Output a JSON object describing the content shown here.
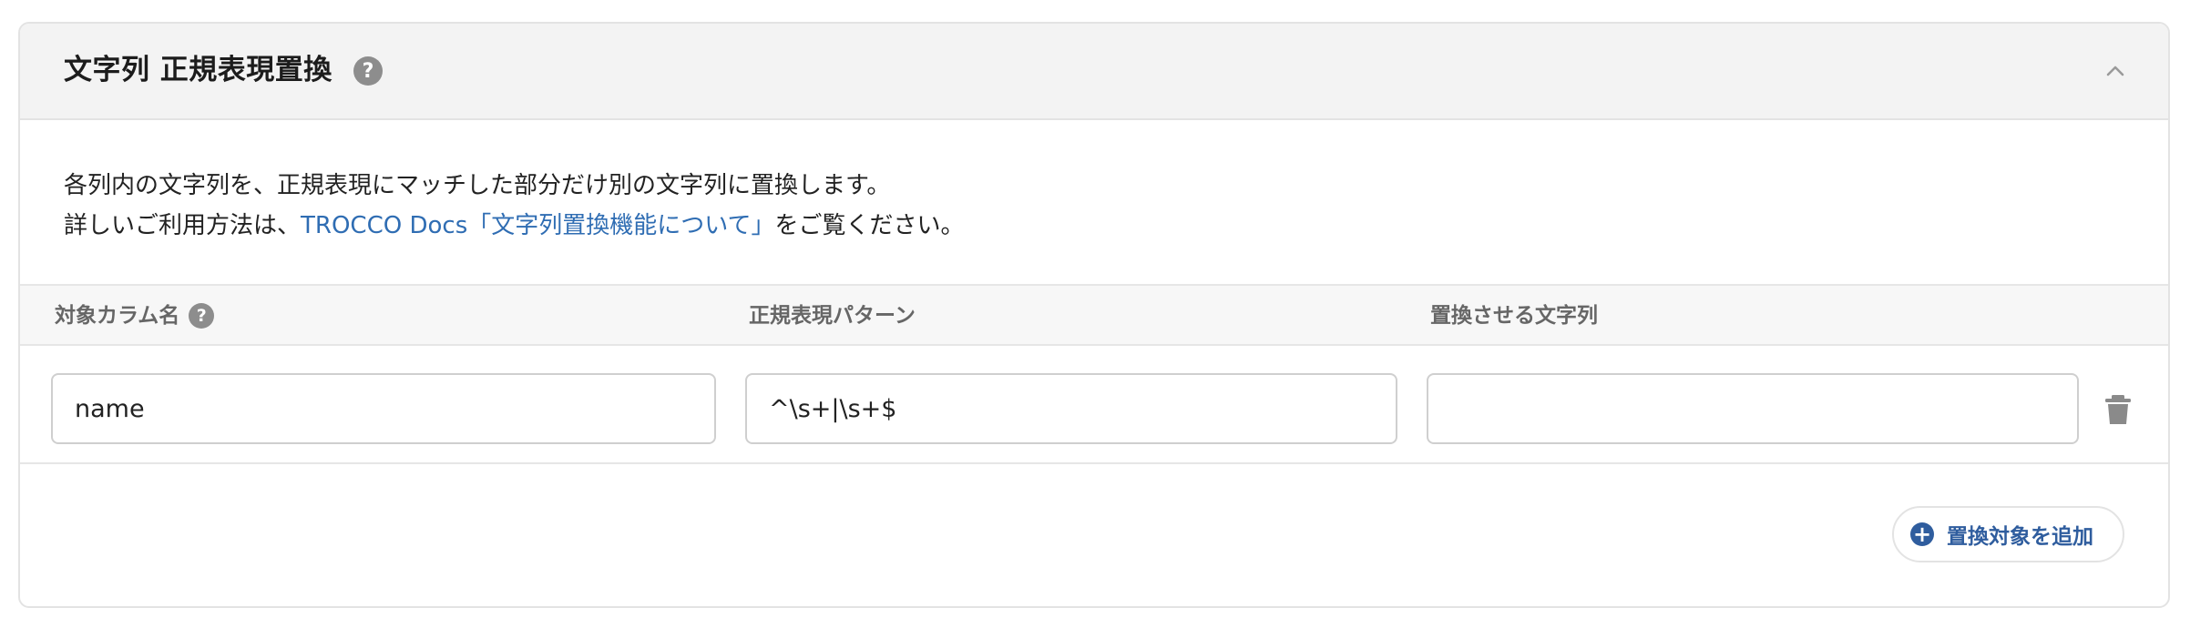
{
  "panel": {
    "title": "文字列 正規表現置換",
    "help_icon": "question-circle-icon",
    "collapse_icon": "chevron-up-icon"
  },
  "description": {
    "line1": "各列内の文字列を、正規表現にマッチした部分だけ別の文字列に置換します。",
    "line2_prefix": "詳しいご利用方法は、",
    "link_text": "TROCCO Docs「文字列置換機能について」",
    "line2_suffix": "をご覧ください。"
  },
  "table": {
    "columns": [
      {
        "label": "対象カラム名",
        "has_help": true
      },
      {
        "label": "正規表現パターン",
        "has_help": false
      },
      {
        "label": "置換させる文字列",
        "has_help": false
      }
    ],
    "rows": [
      {
        "column_name": "name",
        "pattern": "^\\s+|\\s+$",
        "replacement": "",
        "delete_icon": "trash-icon"
      }
    ]
  },
  "add_button": {
    "label": "置換対象を追加",
    "icon": "plus-circle-icon"
  },
  "colors": {
    "link": "#2f6db3",
    "accent": "#2f5d9e",
    "header_bg": "#f3f3f3",
    "icon_gray": "#8d8d8d"
  }
}
